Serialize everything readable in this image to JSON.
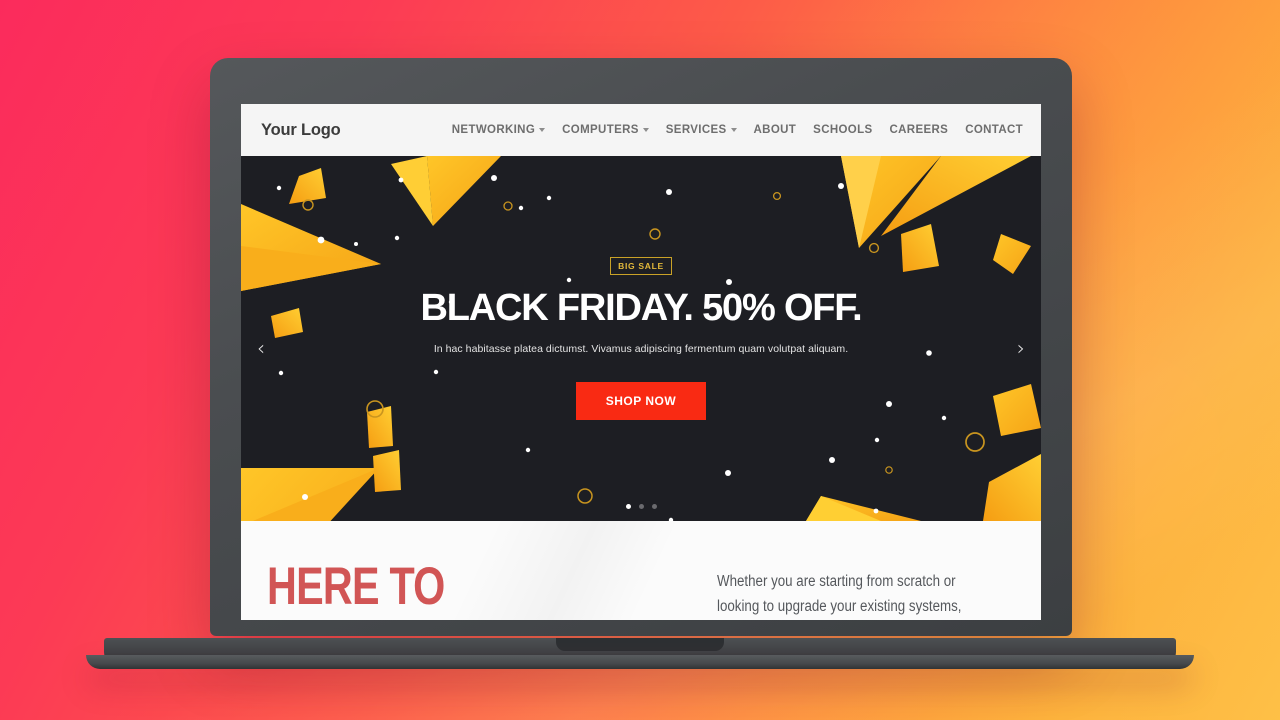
{
  "background": {
    "gradient_from": "#fb2b5c",
    "gradient_mid": "#fe8c3e",
    "gradient_to": "#fec045"
  },
  "device": {
    "type": "laptop-mockup",
    "bezel_color": "#4a4d50"
  },
  "site": {
    "header": {
      "logo": "Your Logo",
      "nav": [
        {
          "label": "NETWORKING",
          "has_dropdown": true
        },
        {
          "label": "COMPUTERS",
          "has_dropdown": true
        },
        {
          "label": "SERVICES",
          "has_dropdown": true
        },
        {
          "label": "ABOUT",
          "has_dropdown": false
        },
        {
          "label": "SCHOOLS",
          "has_dropdown": false
        },
        {
          "label": "CAREERS",
          "has_dropdown": false
        },
        {
          "label": "CONTACT",
          "has_dropdown": false
        }
      ]
    },
    "hero": {
      "badge": "BIG SALE",
      "title": "BLACK FRIDAY. 50% OFF.",
      "subtitle": "In hac habitasse platea dictumst. Vivamus adipiscing fermentum quam volutpat aliquam.",
      "cta_label": "SHOP NOW",
      "cta_color": "#f92a13",
      "background_color": "#1d1e23",
      "accent_color": "#fbb518",
      "prev_arrow": "‹",
      "next_arrow": "›",
      "dots": [
        {
          "active": true
        },
        {
          "active": false
        },
        {
          "active": false
        }
      ]
    },
    "lower": {
      "heading": "HERE TO",
      "heading_color": "#d15555",
      "body": "Whether you are starting from scratch or looking to upgrade your existing systems,"
    }
  }
}
